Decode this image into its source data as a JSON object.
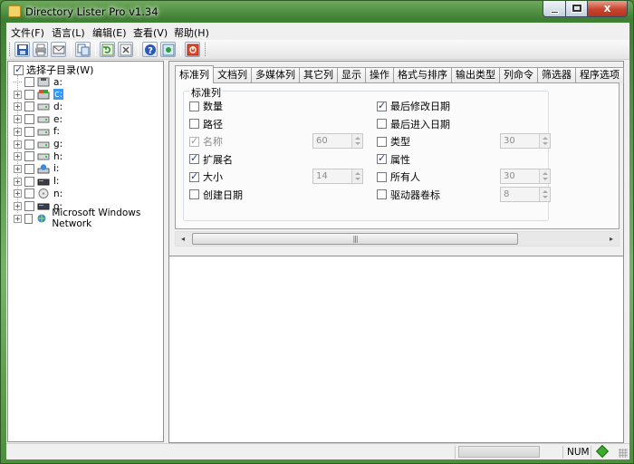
{
  "window": {
    "title": "Directory Lister Pro v1.34",
    "close_glyph": "x"
  },
  "menu": [
    "文件(F)",
    "语言(L)",
    "编辑(E)",
    "查看(V)",
    "帮助(H)"
  ],
  "toolbar": {
    "icons": [
      "save-icon",
      "print-icon",
      "email-icon",
      "copy-icon",
      "refresh-icon",
      "stop-icon",
      "help-icon",
      "info-icon",
      "exit-icon"
    ]
  },
  "tree": {
    "root_label": "选择子目录(W)",
    "root_checked": true,
    "items": [
      {
        "label": "a:",
        "icon": "floppy-drive-icon",
        "expandable": false,
        "selected": false
      },
      {
        "label": "c:",
        "icon": "system-drive-icon",
        "expandable": true,
        "selected": true
      },
      {
        "label": "d:",
        "icon": "hard-drive-icon",
        "expandable": true,
        "selected": false
      },
      {
        "label": "e:",
        "icon": "hard-drive-icon",
        "expandable": true,
        "selected": false
      },
      {
        "label": "f:",
        "icon": "hard-drive-icon",
        "expandable": true,
        "selected": false
      },
      {
        "label": "g:",
        "icon": "hard-drive-icon",
        "expandable": true,
        "selected": false
      },
      {
        "label": "h:",
        "icon": "hard-drive-icon",
        "expandable": true,
        "selected": false
      },
      {
        "label": "i:",
        "icon": "network-drive-icon",
        "expandable": true,
        "selected": false
      },
      {
        "label": "l:",
        "icon": "removable-drive-icon",
        "expandable": true,
        "selected": false
      },
      {
        "label": "n:",
        "icon": "cd-drive-icon",
        "expandable": true,
        "selected": false
      },
      {
        "label": "o:",
        "icon": "removable-drive-icon",
        "expandable": true,
        "selected": false
      },
      {
        "label": "Microsoft Windows Network",
        "icon": "network-icon",
        "expandable": true,
        "selected": false
      }
    ]
  },
  "tabs": [
    "标准列",
    "文档列",
    "多媒体列",
    "其它列",
    "显示",
    "操作",
    "格式与排序",
    "输出类型",
    "列命令",
    "筛选器",
    "程序选项"
  ],
  "active_tab": "标准列",
  "standard_columns": {
    "group_label": "标准列",
    "left": [
      {
        "label": "数量",
        "checked": false,
        "disabled": false
      },
      {
        "label": "路径",
        "checked": false,
        "disabled": false
      },
      {
        "label": "名称",
        "checked": true,
        "disabled": true,
        "width": "60"
      },
      {
        "label": "扩展名",
        "checked": true,
        "disabled": false
      },
      {
        "label": "大小",
        "checked": true,
        "disabled": false,
        "width": "14"
      },
      {
        "label": "创建日期",
        "checked": false,
        "disabled": false
      }
    ],
    "right": [
      {
        "label": "最后修改日期",
        "checked": true,
        "disabled": false
      },
      {
        "label": "最后进入日期",
        "checked": false,
        "disabled": false
      },
      {
        "label": "类型",
        "checked": false,
        "disabled": false,
        "width": "30"
      },
      {
        "label": "属性",
        "checked": true,
        "disabled": false
      },
      {
        "label": "所有人",
        "checked": false,
        "disabled": false,
        "width": "30"
      },
      {
        "label": "驱动器卷标",
        "checked": false,
        "disabled": false,
        "width": "8"
      }
    ]
  },
  "status": {
    "num": "NUM"
  },
  "colors": {
    "selection": "#3399ff",
    "led": "#3cab2c",
    "window_frame": "#4f8a3c"
  }
}
